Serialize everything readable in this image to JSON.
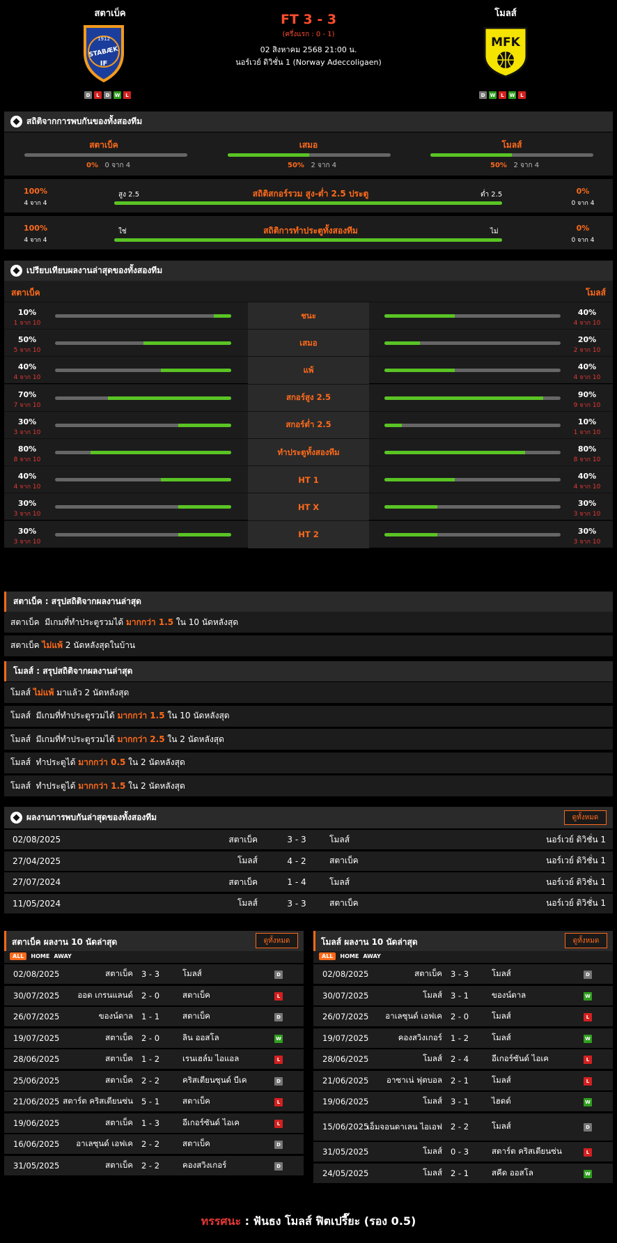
{
  "header": {
    "home": {
      "name": "สตาเบ็ค",
      "form": [
        "D",
        "L",
        "D",
        "W",
        "L"
      ],
      "logo_text": [
        "1912",
        "STABÆK",
        "IF"
      ]
    },
    "away": {
      "name": "โมลส์",
      "form": [
        "D",
        "W",
        "L",
        "W",
        "L"
      ],
      "logo_text": "MFK"
    },
    "score": "FT 3 - 3",
    "halftime": "(ครึ่งแรก : 0 - 1)",
    "date": "02 สิงหาคม 2568 21:00 น.",
    "league": "นอร์เวย์ ดิวิชั่น 1 (Norway Adeccoligaen)"
  },
  "h2h_stats": {
    "title": "สถิติจากการพบกันของทั้งสองทีม",
    "cols": [
      {
        "label": "สตาเบ็ค",
        "pct": "0%",
        "count": "0 จาก 4",
        "value": 0
      },
      {
        "label": "เสมอ",
        "pct": "50%",
        "count": "2 จาก 4",
        "value": 0.5
      },
      {
        "label": "โมลส์",
        "pct": "50%",
        "count": "2 จาก 4",
        "value": 0.5
      }
    ],
    "ou": {
      "left_pct": "100%",
      "left_count": "4 จาก 4",
      "left_label": "สูง 2.5",
      "title": "สถิติสกอร์รวม สูง-ต่ำ 2.5 ประตู",
      "right_label": "ต่ำ 2.5",
      "right_pct": "0%",
      "right_count": "0 จาก 4",
      "value": 1
    },
    "btts": {
      "left_pct": "100%",
      "left_count": "4 จาก 4",
      "left_label": "ใช่",
      "title": "สถิติการทำประตูทั้งสองทีม",
      "right_label": "ไม่",
      "right_pct": "0%",
      "right_count": "0 จาก 4",
      "value": 1
    }
  },
  "compare": {
    "title": "เปรียบเทียบผลงานล่าสุดของทั้งสองทีม",
    "home": "สตาเบ็ค",
    "away": "โมลส์",
    "rows": [
      {
        "label": "ชนะ",
        "lp": "10%",
        "lc": "1 จาก 10",
        "lv": 0.1,
        "rp": "40%",
        "rc": "4 จาก 10",
        "rv": 0.4
      },
      {
        "label": "เสมอ",
        "lp": "50%",
        "lc": "5 จาก 10",
        "lv": 0.5,
        "rp": "20%",
        "rc": "2 จาก 10",
        "rv": 0.2
      },
      {
        "label": "แพ้",
        "lp": "40%",
        "lc": "4 จาก 10",
        "lv": 0.4,
        "rp": "40%",
        "rc": "4 จาก 10",
        "rv": 0.4
      },
      {
        "label": "สกอร์สูง 2.5",
        "lp": "70%",
        "lc": "7 จาก 10",
        "lv": 0.7,
        "rp": "90%",
        "rc": "9 จาก 10",
        "rv": 0.9
      },
      {
        "label": "สกอร์ต่ำ 2.5",
        "lp": "30%",
        "lc": "3 จาก 10",
        "lv": 0.3,
        "rp": "10%",
        "rc": "1 จาก 10",
        "rv": 0.1
      },
      {
        "label": "ทำประตูทั้งสองทีม",
        "lp": "80%",
        "lc": "8 จาก 10",
        "lv": 0.8,
        "rp": "80%",
        "rc": "8 จาก 10",
        "rv": 0.8
      },
      {
        "label": "HT 1",
        "lp": "40%",
        "lc": "4 จาก 10",
        "lv": 0.4,
        "rp": "40%",
        "rc": "4 จาก 10",
        "rv": 0.4
      },
      {
        "label": "HT X",
        "lp": "30%",
        "lc": "3 จาก 10",
        "lv": 0.3,
        "rp": "30%",
        "rc": "3 จาก 10",
        "rv": 0.3
      },
      {
        "label": "HT 2",
        "lp": "30%",
        "lc": "3 จาก 10",
        "lv": 0.3,
        "rp": "30%",
        "rc": "3 จาก 10",
        "rv": 0.3
      }
    ]
  },
  "home_summary": {
    "title": "สตาเบ็ค : สรุปสถิติจากผลงานล่าสุด",
    "rows": [
      [
        {
          "t": "สตาเบ็ค  มีเกมที่ทำประตูรวมได้ "
        },
        {
          "t": "มากกว่า 1.5",
          "o": true
        },
        {
          "t": " ใน 10 นัดหลังสุด"
        }
      ],
      [
        {
          "t": "สตาเบ็ค "
        },
        {
          "t": "ไม่แพ้",
          "o": true
        },
        {
          "t": " 2 นัดหลังสุดในบ้าน"
        }
      ]
    ]
  },
  "away_summary": {
    "title": "โมลส์ : สรุปสถิติจากผลงานล่าสุด",
    "rows": [
      [
        {
          "t": "โมลส์ "
        },
        {
          "t": "ไม่แพ้",
          "o": true
        },
        {
          "t": " มาแล้ว 2 นัดหลังสุด"
        }
      ],
      [
        {
          "t": "โมลส์  มีเกมที่ทำประตูรวมได้ "
        },
        {
          "t": "มากกว่า 1.5",
          "o": true
        },
        {
          "t": " ใน 10 นัดหลังสุด"
        }
      ],
      [
        {
          "t": "โมลส์  มีเกมที่ทำประตูรวมได้ "
        },
        {
          "t": "มากกว่า 2.5",
          "o": true
        },
        {
          "t": " ใน 2 นัดหลังสุด"
        }
      ],
      [
        {
          "t": "โมลส์  ทำประตูได้ "
        },
        {
          "t": "มากกว่า 0.5",
          "o": true
        },
        {
          "t": " ใน 2 นัดหลังสุด"
        }
      ],
      [
        {
          "t": "โมลส์  ทำประตูได้ "
        },
        {
          "t": "มากกว่า 1.5",
          "o": true
        },
        {
          "t": " ใน 2 นัดหลังสุด"
        }
      ]
    ]
  },
  "h2h_results": {
    "title": "ผลงานการพบกันล่าสุดของทั้งสองทีม",
    "view_all": "ดูทั้งหมด",
    "rows": [
      {
        "date": "02/08/2025",
        "home": "สตาเบ็ค",
        "score": "3 - 3",
        "away": "โมลส์",
        "league": "นอร์เวย์ ดิวิชั่น 1"
      },
      {
        "date": "27/04/2025",
        "home": "โมลส์",
        "score": "4 - 2",
        "away": "สตาเบ็ค",
        "league": "นอร์เวย์ ดิวิชั่น 1"
      },
      {
        "date": "27/07/2024",
        "home": "สตาเบ็ค",
        "score": "1 - 4",
        "away": "โมลส์",
        "league": "นอร์เวย์ ดิวิชั่น 1"
      },
      {
        "date": "11/05/2024",
        "home": "โมลส์",
        "score": "3 - 3",
        "away": "สตาเบ็ค",
        "league": "นอร์เวย์ ดิวิชั่น 1"
      }
    ]
  },
  "home_last10": {
    "title": "สตาเบ็ค ผลงาน 10 นัดล่าสุด",
    "view_all": "ดูทั้งหมด",
    "tabs": [
      "ALL",
      "HOME",
      "AWAY"
    ],
    "rows": [
      {
        "date": "02/08/2025",
        "home": "สตาเบ็ค",
        "score": "3 - 3",
        "away": "โมลส์",
        "res": "D"
      },
      {
        "date": "30/07/2025",
        "home": "ออด เกรนแลนด์",
        "score": "2 - 0",
        "away": "สตาเบ็ค",
        "res": "L"
      },
      {
        "date": "26/07/2025",
        "home": "ของน์ดาล",
        "score": "1 - 1",
        "away": "สตาเบ็ค",
        "res": "D"
      },
      {
        "date": "19/07/2025",
        "home": "สตาเบ็ค",
        "score": "2 - 0",
        "away": "ลิน ออสโล",
        "res": "W"
      },
      {
        "date": "28/06/2025",
        "home": "สตาเบ็ค",
        "score": "1 - 2",
        "away": "เรนเฮล์ม ไอแอล",
        "res": "L"
      },
      {
        "date": "25/06/2025",
        "home": "สตาเบ็ค",
        "score": "2 - 2",
        "away": "คริสเตียนซุนด์ บีเค",
        "res": "D"
      },
      {
        "date": "21/06/2025",
        "home": "สตาร์ต คริสเตียนซ่น",
        "score": "5 - 1",
        "away": "สตาเบ็ค",
        "res": "L"
      },
      {
        "date": "19/06/2025",
        "home": "สตาเบ็ค",
        "score": "1 - 3",
        "away": "อีเกอร์ซันด์ ไอเค",
        "res": "L"
      },
      {
        "date": "16/06/2025",
        "home": "อาเลซุนด์ เอฟเค",
        "score": "2 - 2",
        "away": "สตาเบ็ค",
        "res": "D"
      },
      {
        "date": "31/05/2025",
        "home": "สตาเบ็ค",
        "score": "2 - 2",
        "away": "คองสวิงเกอร์",
        "res": "D"
      }
    ]
  },
  "away_last10": {
    "title": "โมลส์ ผลงาน 10 นัดล่าสุด",
    "view_all": "ดูทั้งหมด",
    "tabs": [
      "ALL",
      "HOME",
      "AWAY"
    ],
    "rows": [
      {
        "date": "02/08/2025",
        "home": "สตาเบ็ค",
        "score": "3 - 3",
        "away": "โมลส์",
        "res": "D"
      },
      {
        "date": "30/07/2025",
        "home": "โมลส์",
        "score": "3 - 1",
        "away": "ของน์ดาล",
        "res": "W"
      },
      {
        "date": "26/07/2025",
        "home": "อาเลซุนด์ เอฟเค",
        "score": "2 - 0",
        "away": "โมลส์",
        "res": "L"
      },
      {
        "date": "19/07/2025",
        "home": "คองสวิงเกอร์",
        "score": "1 - 2",
        "away": "โมลส์",
        "res": "W"
      },
      {
        "date": "28/06/2025",
        "home": "โมลส์",
        "score": "2 - 4",
        "away": "อีเกอร์ซันด์ ไอเค",
        "res": "L"
      },
      {
        "date": "21/06/2025",
        "home": "อาซาเน่ ฟุตบอล",
        "score": "2 - 1",
        "away": "โมลส์",
        "res": "L"
      },
      {
        "date": "19/06/2025",
        "home": "โมลส์",
        "score": "3 - 1",
        "away": "ไฮดต์",
        "res": "W"
      },
      {
        "date": "15/06/2025",
        "home": "เอ็มจอนดาเลน ไอเอฟ",
        "score": "2 - 2",
        "away": "โมลส์",
        "res": "D",
        "tall": true
      },
      {
        "date": "31/05/2025",
        "home": "โมลส์",
        "score": "0 - 3",
        "away": "สตาร์ต คริสเตียนซ่น",
        "res": "L"
      },
      {
        "date": "24/05/2025",
        "home": "โมลส์",
        "score": "2 - 1",
        "away": "สคีด ออสโล",
        "res": "W"
      }
    ]
  },
  "prediction": {
    "label": "ทรรศนะ",
    "sep": " : ",
    "text": "ฟันธง โมลส์ ฟิตเปรี๊ยะ (รอง 0.5)"
  },
  "colors": {
    "accent": "#ff6a1a",
    "bar_fill": "#5ac424",
    "win": "#2f9e1f",
    "loss": "#d32020",
    "draw": "#777777"
  }
}
